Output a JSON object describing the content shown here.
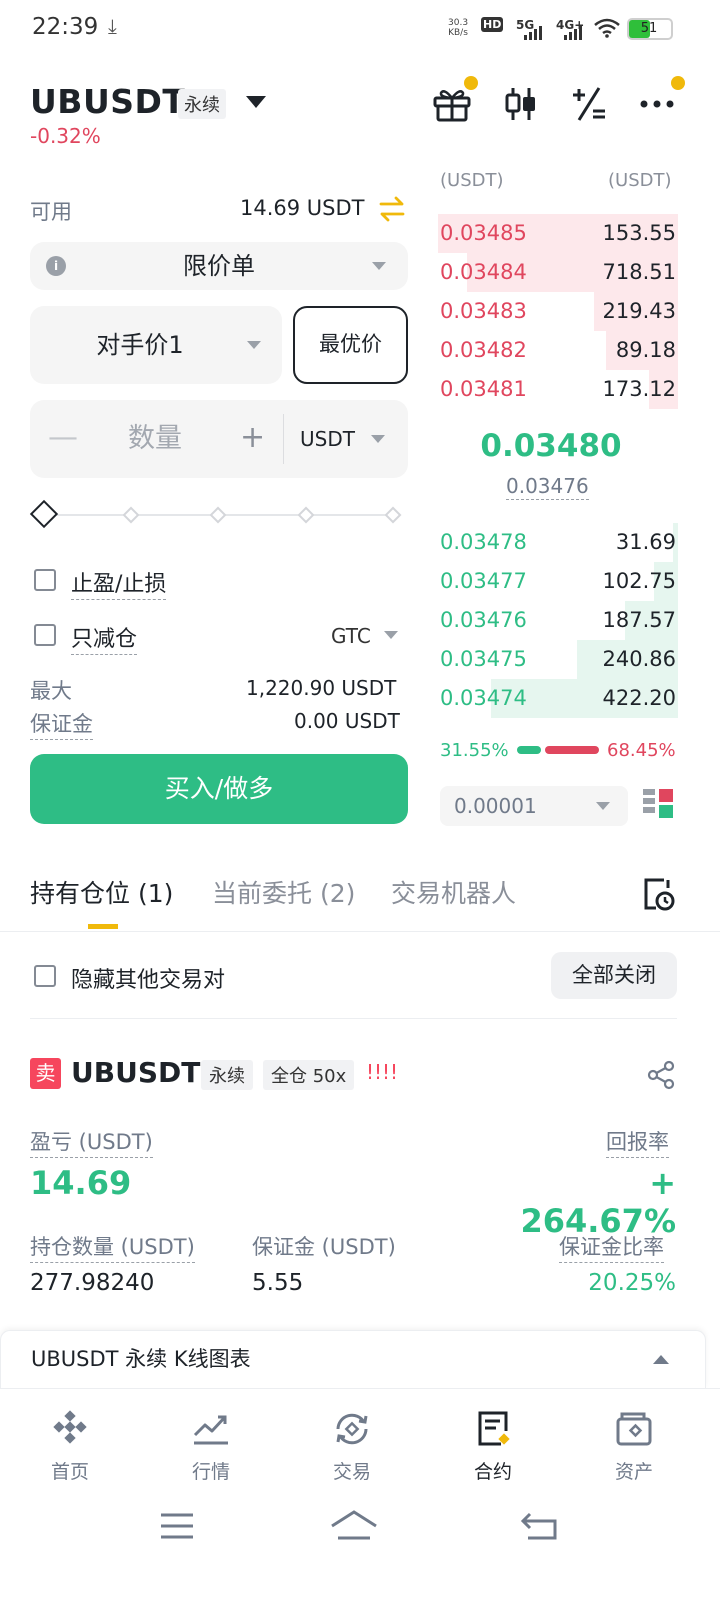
{
  "status_bar": {
    "time": "22:39",
    "net_speed_value": "30.3",
    "net_speed_unit": "KB/s",
    "hd": "HD",
    "sim1": "5G",
    "sim2": "4G+",
    "battery": "51",
    "battery_level": 0.51
  },
  "header": {
    "symbol": "UBUSDT",
    "contract_tag": "永续",
    "change": "-0.32%",
    "icons": [
      "gift-icon",
      "candlestick-icon",
      "calculator-icon",
      "more-icon"
    ]
  },
  "form": {
    "available_label": "可用",
    "available_value": "14.69 USDT",
    "order_type": "限价单",
    "price_mode": "对手价1",
    "best_price_button": "最优价",
    "quantity_placeholder": "数量",
    "quantity_minus": "—",
    "quantity_plus": "+",
    "quantity_unit": "USDT",
    "tpsl_label": "止盈/止损",
    "reduce_only_label": "只减仓",
    "tif": "GTC",
    "max_label": "最大",
    "max_value": "1,220.90 USDT",
    "margin_label": "保证金",
    "margin_value": "0.00 USDT",
    "buy_button": "买入/做多"
  },
  "orderbook": {
    "header_price": "(USDT)",
    "header_qty": "(USDT)",
    "asks": [
      {
        "price": "0.03485",
        "qty": "153.55",
        "depth": 1.0
      },
      {
        "price": "0.03484",
        "qty": "718.51",
        "depth": 0.88
      },
      {
        "price": "0.03483",
        "qty": "219.43",
        "depth": 0.35
      },
      {
        "price": "0.03482",
        "qty": "89.18",
        "depth": 0.3
      },
      {
        "price": "0.03481",
        "qty": "173.12",
        "depth": 0.12
      }
    ],
    "last_price": "0.03480",
    "mark_price": "0.03476",
    "bids": [
      {
        "price": "0.03478",
        "qty": "31.69",
        "depth": 0.02
      },
      {
        "price": "0.03477",
        "qty": "102.75",
        "depth": 0.1
      },
      {
        "price": "0.03476",
        "qty": "187.57",
        "depth": 0.22
      },
      {
        "price": "0.03475",
        "qty": "240.86",
        "depth": 0.42
      },
      {
        "price": "0.03474",
        "qty": "422.20",
        "depth": 0.78
      }
    ],
    "buy_ratio": "31.55%",
    "sell_ratio": "68.45%",
    "tick_size": "0.00001"
  },
  "tabs": {
    "positions": "持有仓位 (1)",
    "open_orders": "当前委托 (2)",
    "bots": "交易机器人"
  },
  "list_controls": {
    "hide_others": "隐藏其他交易对",
    "close_all": "全部关闭"
  },
  "position": {
    "side": "卖",
    "symbol": "UBUSDT",
    "contract_tag": "永续",
    "margin_mode": "全仓 50x",
    "alert": "!!!!",
    "pnl_label": "盈亏 (USDT)",
    "pnl_value": "14.69",
    "roe_label": "回报率",
    "roe_value": "+ 264.67%",
    "size_label": "持仓数量 (USDT)",
    "size_value": "277.98240",
    "margin_label": "保证金 (USDT)",
    "margin_value": "5.55",
    "margin_ratio_label": "保证金比率",
    "margin_ratio_value": "20.25%"
  },
  "chart_bar": {
    "label": "UBUSDT 永续 K线图表"
  },
  "bottom_nav": {
    "items": [
      {
        "label": "首页",
        "icon": "home-logo-icon"
      },
      {
        "label": "行情",
        "icon": "market-chart-icon"
      },
      {
        "label": "交易",
        "icon": "trade-swap-icon"
      },
      {
        "label": "合约",
        "icon": "futures-document-icon"
      },
      {
        "label": "资产",
        "icon": "wallet-icon"
      }
    ],
    "active_index": 3
  },
  "colors": {
    "buy": "#2ebd85",
    "sell": "#e0465e",
    "accent": "#f0b90b"
  }
}
